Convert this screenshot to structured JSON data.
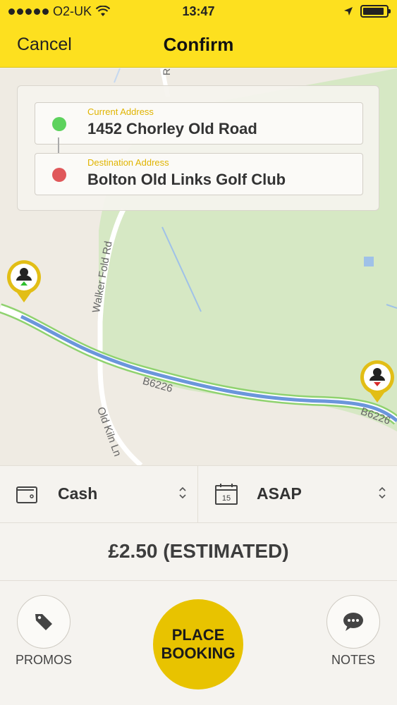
{
  "status_bar": {
    "carrier": "O2-UK",
    "time": "13:47",
    "signal_dots": 5,
    "battery_level": 0.9
  },
  "nav": {
    "cancel_label": "Cancel",
    "title": "Confirm"
  },
  "map": {
    "roads": {
      "walker_fold": "Walker Fold Rd",
      "b6226_a": "B6226",
      "b6226_b": "B6226",
      "old_kiln": "Old Kiln Ln",
      "top_road": "Rd"
    }
  },
  "addresses": {
    "current_label": "Current Address",
    "current_value": "1452 Chorley Old Road",
    "destination_label": "Destination Address",
    "destination_value": "Bolton Old Links Golf Club"
  },
  "options": {
    "payment_label": "Cash",
    "time_label": "ASAP",
    "calendar_day": "15"
  },
  "price": {
    "text": "£2.50 (ESTIMATED)"
  },
  "actions": {
    "promos_label": "PROMOS",
    "place_booking_label": "PLACE BOOKING",
    "notes_label": "NOTES"
  },
  "colors": {
    "brand_yellow": "#fde01f",
    "button_yellow": "#e8c300",
    "origin_green": "#5dd25d",
    "destination_red": "#e0585a",
    "label_gold": "#e0b400",
    "route_blue": "#6b96db"
  }
}
